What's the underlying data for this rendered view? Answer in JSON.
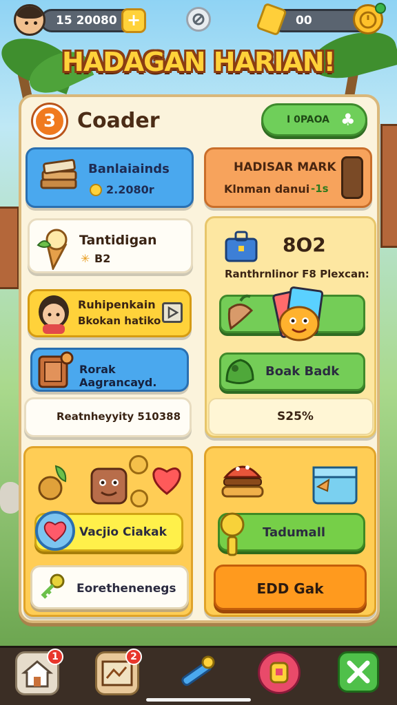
{
  "topbar": {
    "coins": "15 20080",
    "plus_label": "+",
    "gems": "00"
  },
  "banner": {
    "title": "HADAGAN HARIAN!"
  },
  "panel": {
    "level": "3",
    "title": "Coader",
    "green_pill_label": "I 0PAOA"
  },
  "cards": {
    "blue": {
      "title": "Banlaiainds",
      "value": "2.2080r"
    },
    "orange": {
      "title": "HADISAR MARK",
      "subtitle": "Klnman danui",
      "tag": "-1s"
    },
    "white": {
      "title": "Tantidigan",
      "value": "B2"
    },
    "yellow": {
      "title": "Ruhipenkain",
      "subtitle": "Bkokan hatiko"
    },
    "blue2": {
      "title": "Rorak Aagrancayd."
    },
    "white2": {
      "title": "Reatnheyyity 510388"
    }
  },
  "right_box": {
    "number": "8O2",
    "description": "Ranthrnlinor F8 Plexcan:",
    "row_b_label": "Boak Badk",
    "percent": "S25%"
  },
  "bottom_left": {
    "yellow_button": "Vacjio Ciakak",
    "white_button": "Eorethenenegs"
  },
  "bottom_right": {
    "green_button": "Tadumall",
    "orange_button": "EDD Gak"
  },
  "nav": {
    "home_badge": "1",
    "map_badge": "2"
  },
  "colors": {
    "orange_accent": "#f07a1f",
    "green_accent": "#74cd57",
    "blue_accent": "#4aa8ee",
    "yellow_accent": "#ffd23a"
  }
}
